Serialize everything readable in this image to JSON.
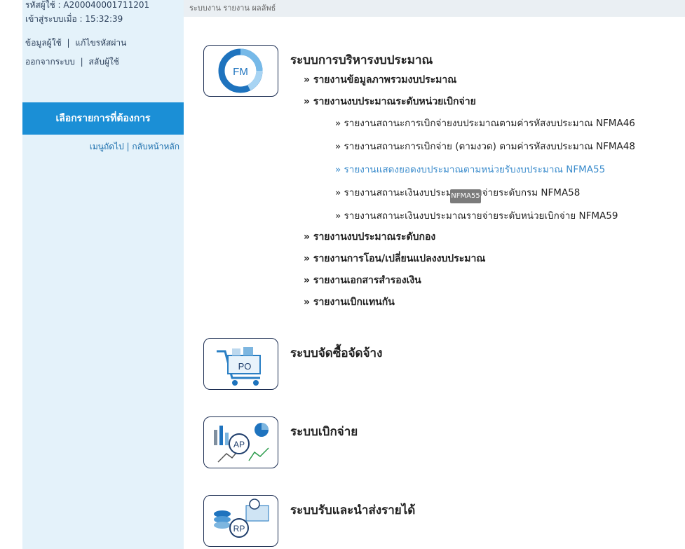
{
  "sidebar": {
    "user_code": "รหัสผู้ใช้ : A200040001711201",
    "login_time": "เข้าสู่ระบบเมื่อ : 15:32:39",
    "link_profile": "ข้อมูลผู้ใช้",
    "link_password": "แก้ไขรหัสผ่าน",
    "link_logout": "ออกจากระบบ",
    "link_switch": "สลับผู้ใช้",
    "separator": "|",
    "menu_header": "เลือกรายการที่ต้องการ",
    "nav_links": "เมนูถัดไป | กลับหน้าหลัก"
  },
  "topbar": {
    "breadcrumb": "ระบบงาน    รายงาน    ผลลัพธ์"
  },
  "systems": [
    {
      "icon_label": "FM",
      "title": "ระบบการบริหารงบประมาณ",
      "items": [
        "» รายงานข้อมูลภาพรวมงบประมาณ",
        "» รายงานงบประมาณระดับหน่วยเบิกจ่าย",
        "» รายงานงบประมาณระดับกอง",
        "» รายงานการโอน/เปลี่ยนแปลงงบประมาณ",
        "» รายงานเอกสารสำรองเงิน",
        "» รายงานเบิกแทนกัน"
      ],
      "subitems": [
        "» รายงานสถานะการเบิกจ่ายงบประมาณตามค่ารหัสงบประมาณ NFMA46",
        "» รายงานสถานะการเบิกจ่าย (ตามงวด) ตามค่ารหัสงบประมาณ NFMA48",
        "» รายงานแสดงยอดงบประมาณตามหน่วยรับงบประมาณ NFMA55",
        "» รายงานสถานะเงินงบประมาณรายจ่ายระดับกรม NFMA58",
        "» รายงานสถานะเงินงบประมาณรายจ่ายระดับหน่วยเบิกจ่าย NFMA59"
      ]
    },
    {
      "icon_label": "PO",
      "title": "ระบบจัดซื้อจัดจ้าง"
    },
    {
      "icon_label": "AP",
      "title": "ระบบเบิกจ่าย"
    },
    {
      "icon_label": "RP",
      "title": "ระบบรับและนำส่งรายได้"
    }
  ],
  "tooltip": "NFMA55",
  "colors": {
    "sidebar_bg": "#e4f2fa",
    "menu_header_bg": "#1b8fd6",
    "active_link": "#3b8ccc",
    "icon_blue": "#1e73be"
  }
}
